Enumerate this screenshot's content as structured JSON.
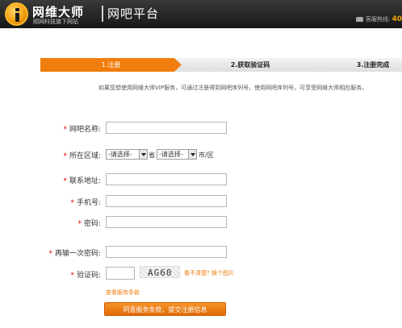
{
  "header": {
    "brand": "网维大师",
    "brand_sub": "顺网科技旗下网站",
    "title": "网吧平台",
    "hotline_label": "客服热线:",
    "hotline_number": "40"
  },
  "steps": [
    {
      "label": "1.注册",
      "active": true
    },
    {
      "label": "2.获取验证码",
      "active": false
    },
    {
      "label": "3.注册完成",
      "active": false
    }
  ],
  "intro": "如果您想使用网维大师VIP服务，可通过注册得到网吧序列号。使用网吧序列号，可享受网维大师相应服务。",
  "form": {
    "cafe_name": {
      "label": "网吧名称:",
      "value": ""
    },
    "region": {
      "label": "所在区域:",
      "province_selected": "-请选择-",
      "province_unit": "省",
      "city_selected": "-请选择-",
      "city_unit": "市/区"
    },
    "address": {
      "label": "联系地址:",
      "value": ""
    },
    "phone": {
      "label": "手机号:",
      "value": ""
    },
    "password": {
      "label": "密码:",
      "value": ""
    },
    "password_confirm": {
      "label": "再输一次密码:",
      "value": ""
    },
    "captcha": {
      "label": "验证码:",
      "value": "",
      "image_text": "AG60",
      "refresh_text": "看不清楚? 换个图片"
    },
    "required_mark": "*",
    "terms_link": "查看服务条款",
    "submit_label": "同意服务条款，提交注册信息"
  },
  "colors": {
    "accent": "#f07d0e",
    "required": "#e60000",
    "header_bg": "#1f1f1f"
  }
}
